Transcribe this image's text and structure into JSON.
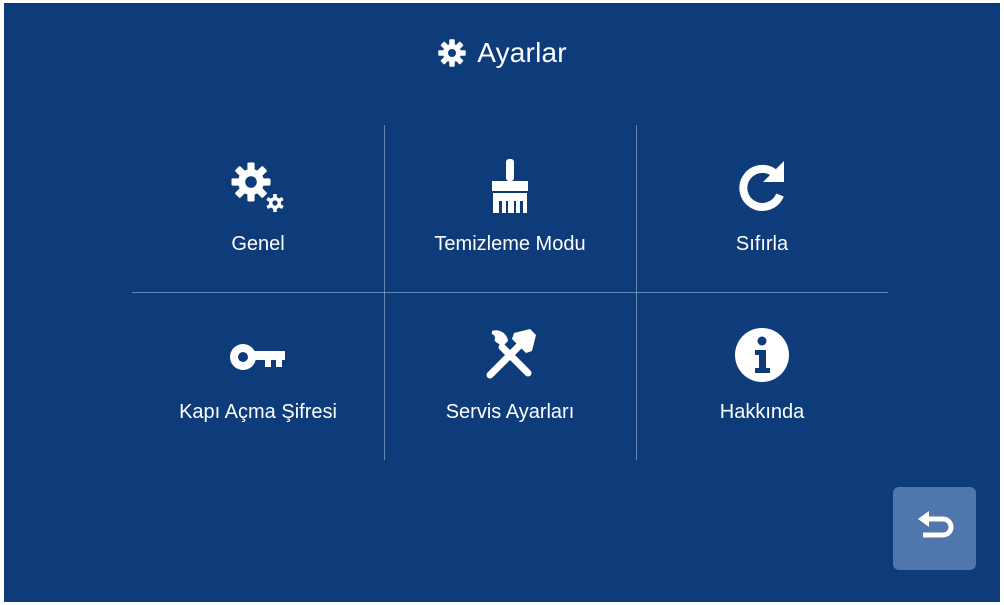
{
  "header": {
    "title": "Ayarlar",
    "icon": "gear-icon"
  },
  "menu": {
    "items": [
      {
        "label": "Genel",
        "icon": "gears-icon"
      },
      {
        "label": "Temizleme Modu",
        "icon": "broom-icon"
      },
      {
        "label": "Sıfırla",
        "icon": "reset-icon"
      },
      {
        "label": "Kapı Açma Şifresi",
        "icon": "key-icon"
      },
      {
        "label": "Servis Ayarları",
        "icon": "tools-icon"
      },
      {
        "label": "Hakkında",
        "icon": "info-icon"
      }
    ]
  },
  "footer": {
    "back_icon": "back-arrow-icon"
  },
  "colors": {
    "background": "#0e3b7a",
    "divider": "#adc4e6",
    "back_button": "#4f77ae",
    "foreground": "#ffffff"
  }
}
